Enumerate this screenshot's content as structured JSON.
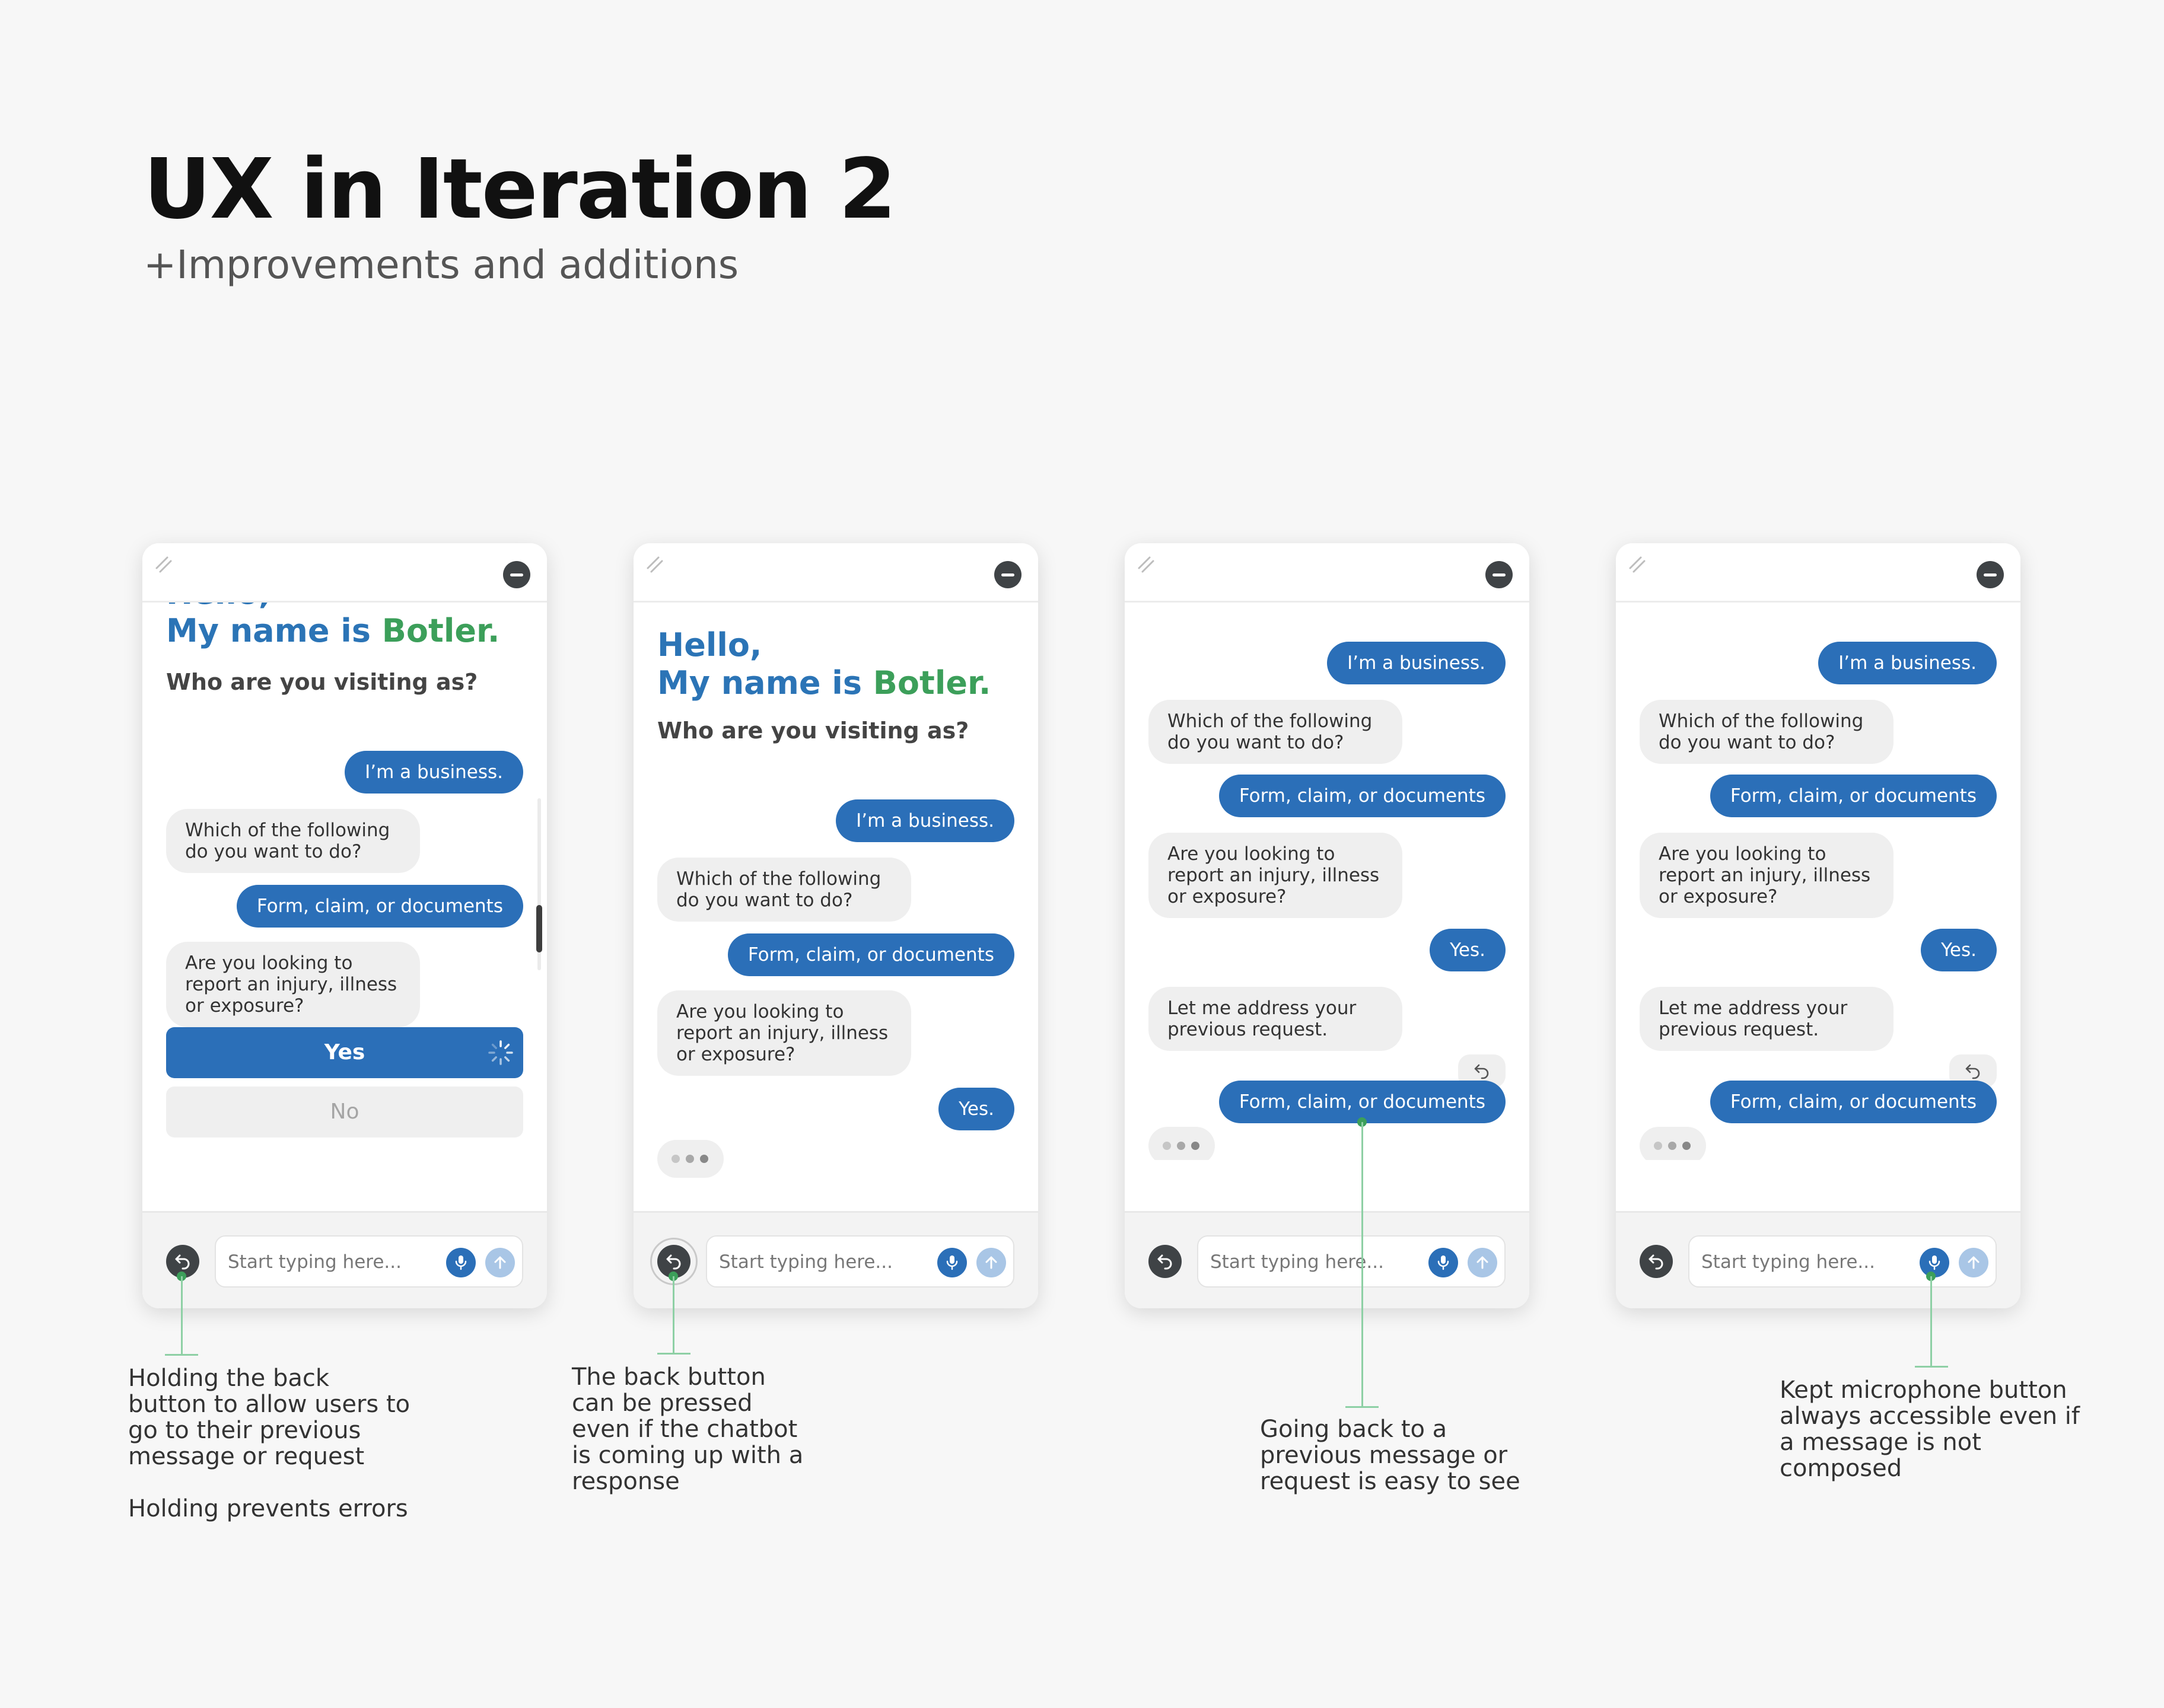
{
  "page": {
    "title": "UX in Iteration 2",
    "subtitle": "+Improvements and additions"
  },
  "chat": {
    "hello": "Hello,",
    "name_prefix": "My name is ",
    "name": "Botler.",
    "visit_question": "Who are you visiting as?",
    "user_business": "I’m a business.",
    "bot_which": "Which of the following do you want to do?",
    "user_form": "Form, claim, or documents",
    "bot_injury": "Are you looking to report an injury, illness or exposure?",
    "user_yes": "Yes.",
    "bot_address": "Let me address your previous request.",
    "choice_yes": "Yes",
    "choice_no": "No",
    "input_placeholder": "Start typing here..."
  },
  "icons": {
    "minimize": "minus-circle-icon",
    "drag": "resize-grip-icon",
    "back": "undo-arrow-icon",
    "mic": "microphone-icon",
    "send": "arrow-up-icon",
    "spinner": "loading-spinner-icon"
  },
  "annotations": {
    "a1_line1": "Holding the back button to allow users to go to their previous message or request",
    "a1_line2": "Holding prevents errors",
    "a2": "The back button can be pressed even if the chatbot is coming up with a response",
    "a3": "Going back to a previous message or request is easy to see",
    "a4": "Kept microphone button always accessible even if a message is not composed"
  },
  "colors": {
    "primary_blue": "#2b6fb8",
    "brand_green": "#3c9f5a",
    "annotation_green": "#8ed0a5",
    "bot_bubble": "#efefef"
  }
}
